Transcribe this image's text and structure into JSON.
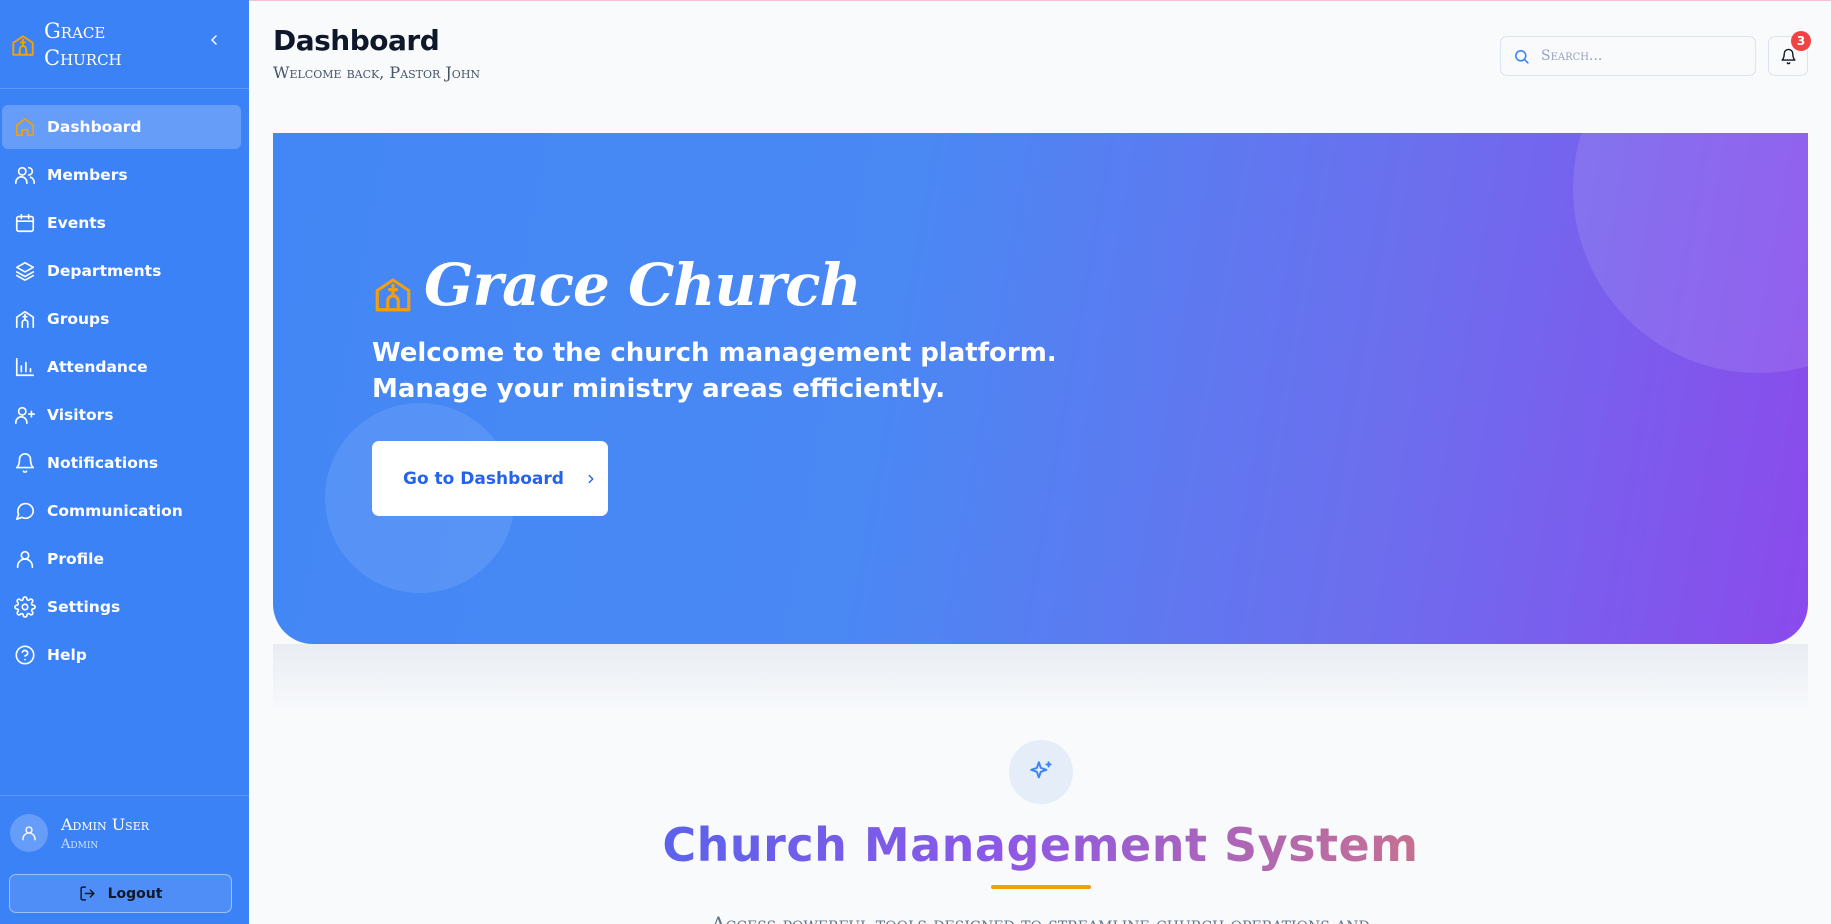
{
  "brand": {
    "name_line1": "Grace",
    "name_line2": "Church",
    "accent_color": "#f59e0b"
  },
  "sidebar": {
    "collapse_icon": "chevron-left-icon",
    "items": [
      {
        "label": "Dashboard",
        "icon": "home-icon",
        "active": true
      },
      {
        "label": "Members",
        "icon": "users-icon"
      },
      {
        "label": "Events",
        "icon": "calendar-icon"
      },
      {
        "label": "Departments",
        "icon": "layers-icon"
      },
      {
        "label": "Groups",
        "icon": "building-icon"
      },
      {
        "label": "Attendance",
        "icon": "bar-chart-icon"
      },
      {
        "label": "Visitors",
        "icon": "user-plus-icon"
      },
      {
        "label": "Notifications",
        "icon": "bell-icon"
      },
      {
        "label": "Communication",
        "icon": "message-circle-icon"
      },
      {
        "label": "Profile",
        "icon": "user-icon"
      },
      {
        "label": "Settings",
        "icon": "gear-icon"
      },
      {
        "label": "Help",
        "icon": "help-circle-icon"
      }
    ],
    "user": {
      "name": "Admin User",
      "role": "Admin"
    },
    "logout_label": "Logout",
    "color": "#3b82f6"
  },
  "header": {
    "title": "Dashboard",
    "subtitle": "Welcome back, Pastor John",
    "search_placeholder": "Search...",
    "notification_count": "3"
  },
  "hero": {
    "title": "Grace Church",
    "tagline_line1": "Welcome to the church management platform.",
    "tagline_line2": "Manage your ministry areas efficiently.",
    "button_label": "Go to Dashboard",
    "gradient_start": "#4287f5",
    "gradient_end": "#8b4aec"
  },
  "section": {
    "title": "Church Management System",
    "description": "Access powerful tools designed to streamline church operations and"
  }
}
